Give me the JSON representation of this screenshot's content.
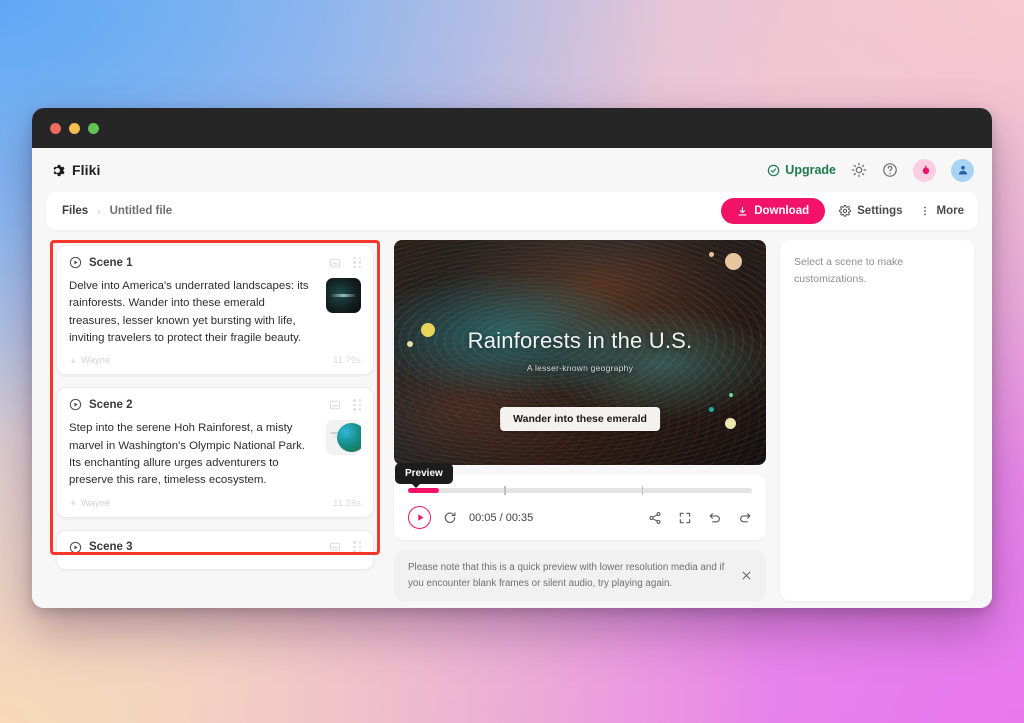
{
  "brand": {
    "name": "Fliki",
    "logo_icon": "gear-logo-icon"
  },
  "header": {
    "upgrade_label": "Upgrade",
    "upgrade_icon": "check-circle-icon",
    "theme_icon": "sun-icon",
    "help_icon": "question-circle-icon",
    "streak_icon": "flame-icon",
    "account_icon": "user-icon",
    "accent_green": "#1f7a4d"
  },
  "toolbar": {
    "breadcrumb": {
      "root": "Files",
      "separator": "›",
      "current": "Untitled file"
    },
    "download_label": "Download",
    "download_icon": "download-icon",
    "settings_label": "Settings",
    "settings_icon": "gear-icon",
    "more_label": "More",
    "more_icon": "kebab-menu-icon",
    "accent_pink": "#f21368"
  },
  "scenes": {
    "annotation_color": "#f5382a",
    "items": [
      {
        "title": "Scene 1",
        "play_icon": "play-circle-icon",
        "media_icon": "image-frame-icon",
        "grip_icon": "drag-handle-icon",
        "text": "Delve into America's underrated landscapes: its rainforests. Wander into these emerald treasures, lesser known yet bursting with life, inviting travelers to protect their fragile beauty.",
        "voice_icon": "voice-icon",
        "voice": "Wayne",
        "duration": "11.79s"
      },
      {
        "title": "Scene 2",
        "play_icon": "play-circle-icon",
        "media_icon": "image-frame-icon",
        "grip_icon": "drag-handle-icon",
        "text": "Step into the serene Hoh Rainforest, a misty marvel in Washington's Olympic National Park. Its enchanting allure urges adventurers to preserve this rare, timeless ecosystem.",
        "voice_icon": "voice-icon",
        "voice": "Wayne",
        "duration": "11.28s"
      },
      {
        "title": "Scene 3",
        "play_icon": "play-circle-icon",
        "media_icon": "image-frame-icon",
        "grip_icon": "drag-handle-icon",
        "text": "",
        "voice_icon": "voice-icon",
        "voice": "",
        "duration": ""
      }
    ]
  },
  "preview": {
    "stage_title": "Rainforests in the U.S.",
    "stage_subtitle": "A lesser-known geography",
    "caption": "Wander into these emerald"
  },
  "player": {
    "tooltip": "Preview",
    "play_icon": "play-icon",
    "restart_icon": "restart-icon",
    "time": "00:05 / 00:35",
    "current_time": "00:05",
    "total_time": "00:35",
    "progress_percent": 9,
    "share_icon": "share-icon",
    "fullscreen_icon": "fullscreen-icon",
    "undo_icon": "undo-icon",
    "redo_icon": "redo-icon"
  },
  "notice": {
    "text": "Please note that this is a quick preview with lower resolution media and if you encounter blank frames or silent audio, try playing again.",
    "close_icon": "close-icon"
  },
  "inspector": {
    "empty_message": "Select a scene to make customizations."
  },
  "window_controls": {
    "close": "close",
    "minimize": "minimize",
    "zoom": "zoom"
  }
}
